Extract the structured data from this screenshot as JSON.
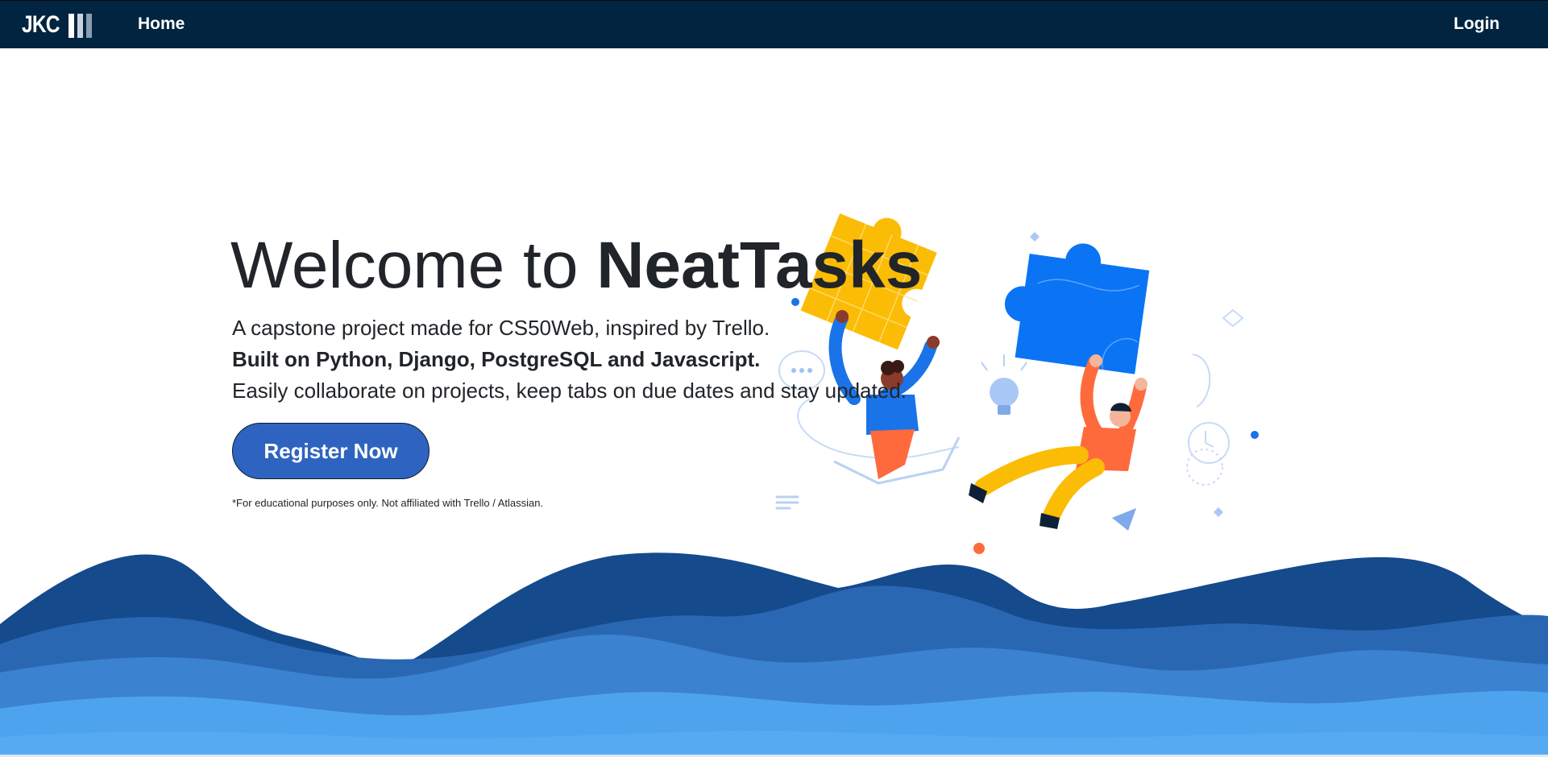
{
  "navbar": {
    "brand": {
      "text": "JKC",
      "bar_colors": [
        "#ffffff",
        "#c9d3dd",
        "#8a9db1"
      ],
      "icon": "jkc-logo"
    },
    "home_label": "Home",
    "login_label": "Login",
    "background": "#012440"
  },
  "hero": {
    "title_prefix": "Welcome to ",
    "title_brand": "NeatTasks",
    "line1": "A capstone project made for CS50Web, inspired by Trello.",
    "line2": "Built on Python, Django, PostgreSQL and Javascript.",
    "line3": "Easily collaborate on projects, keep tabs on due dates and stay updated.",
    "register_label": "Register Now",
    "disclaimer": "*For educational purposes only. Not affiliated with Trello / Atlassian."
  },
  "illustration": {
    "icon": "people-holding-puzzle-pieces-illustration",
    "colors": {
      "yellow_piece": "#fbbc05",
      "blue_piece": "#0b74f5",
      "orange": "#ff6a3d",
      "accent_blue": "#1a73e8"
    }
  },
  "waves": {
    "colors": [
      "#154a8c",
      "#2a67b3",
      "#3b82d0",
      "#4ea3ee"
    ]
  }
}
